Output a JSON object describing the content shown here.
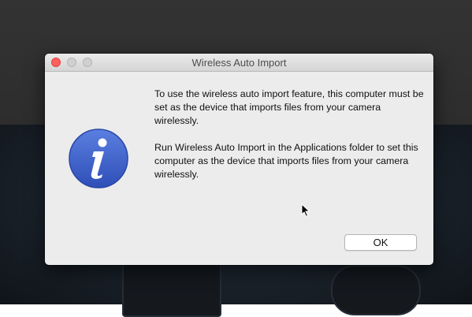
{
  "dialog": {
    "title": "Wireless Auto Import",
    "icon": "info-icon",
    "message_1": "To use the wireless auto import feature, this computer must be set as the device that imports files from your camera wirelessly.",
    "message_2": "Run Wireless Auto Import in the Applications folder to set this computer as the device that imports files from your camera wirelessly.",
    "ok_label": "OK"
  },
  "colors": {
    "icon_blue": "#3d63c8",
    "close_button": "#fc605c"
  }
}
